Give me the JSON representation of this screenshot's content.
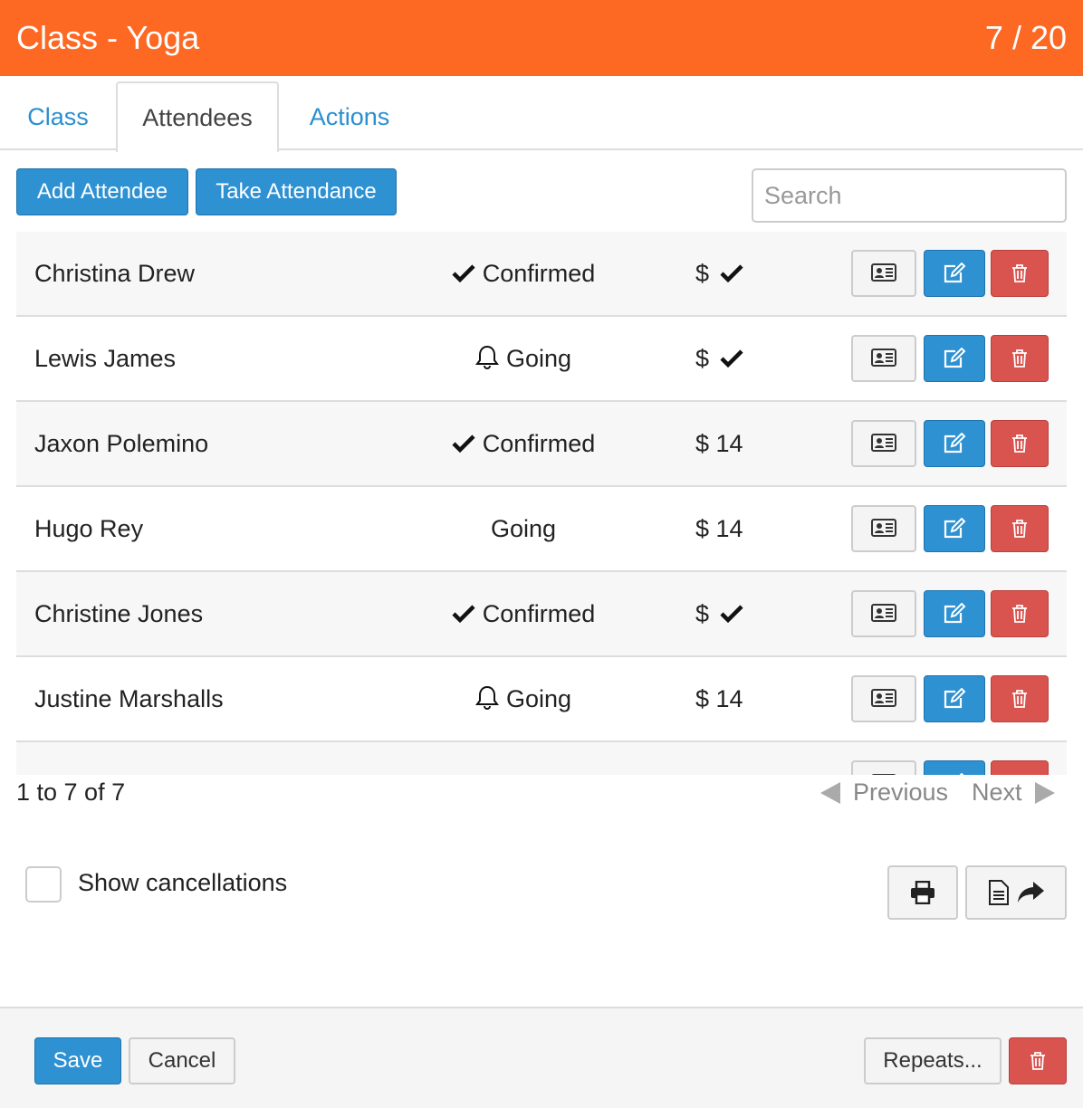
{
  "header": {
    "title": "Class - Yoga",
    "count": "7 / 20"
  },
  "tabs": [
    {
      "label": "Class"
    },
    {
      "label": "Attendees",
      "active": true
    },
    {
      "label": "Actions"
    }
  ],
  "toolbar": {
    "add": "Add Attendee",
    "take": "Take Attendance",
    "search_placeholder": "Search"
  },
  "rows": [
    {
      "name": "Christina Drew",
      "status": "Confirmed",
      "status_icon": "check",
      "payment": "$",
      "paid_icon": "check"
    },
    {
      "name": "Lewis James",
      "status": "Going",
      "status_icon": "bell",
      "payment": "$",
      "paid_icon": "check"
    },
    {
      "name": "Jaxon Polemino",
      "status": "Confirmed",
      "status_icon": "check",
      "payment": "$ 14"
    },
    {
      "name": "Hugo Rey",
      "status": "Going",
      "payment": "$ 14"
    },
    {
      "name": "Christine Jones",
      "status": "Confirmed",
      "status_icon": "check",
      "payment": "$",
      "paid_icon": "check"
    },
    {
      "name": "Justine Marshalls",
      "status": "Going",
      "status_icon": "bell",
      "payment": "$ 14"
    }
  ],
  "pagination": {
    "info": "1 to 7 of 7",
    "previous": "Previous",
    "next": "Next"
  },
  "options": {
    "show_cancellations": "Show cancellations",
    "checked": false
  },
  "footer": {
    "save": "Save",
    "cancel": "Cancel",
    "repeats": "Repeats..."
  },
  "colors": {
    "header": "#fd6823",
    "primary": "#2d91d2",
    "danger": "#d9534f"
  }
}
